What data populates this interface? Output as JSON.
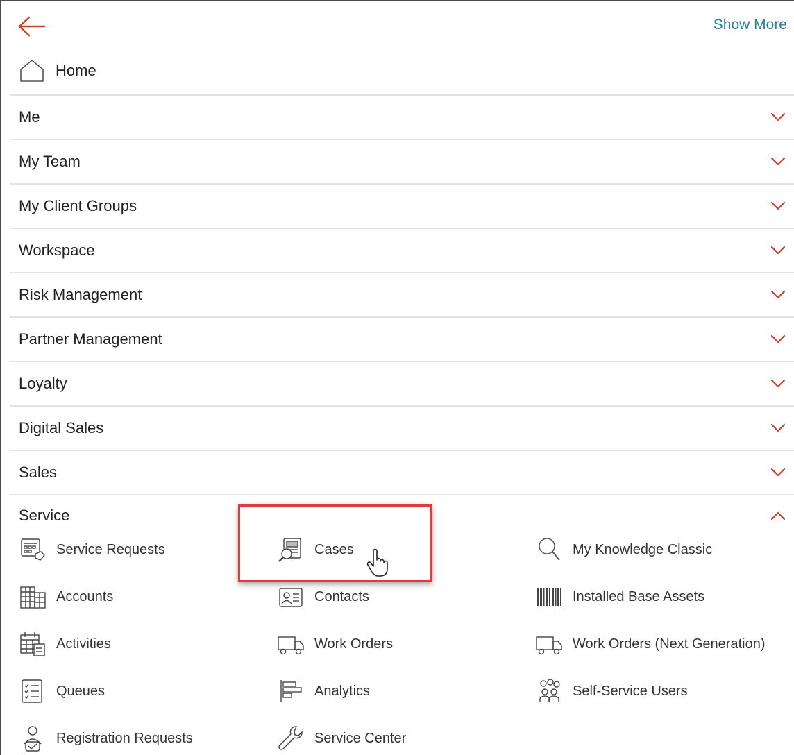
{
  "header": {
    "show_more_label": "Show More",
    "home_label": "Home",
    "colors": {
      "accent": "#c8412f",
      "link": "#2a7f96",
      "highlight": "#e03a3a"
    }
  },
  "nav": {
    "items": [
      {
        "label": "Me",
        "icon": "chevron-down-icon"
      },
      {
        "label": "My Team",
        "icon": "chevron-down-icon"
      },
      {
        "label": "My Client Groups",
        "icon": "chevron-down-icon"
      },
      {
        "label": "Workspace",
        "icon": "chevron-down-icon"
      },
      {
        "label": "Risk Management",
        "icon": "chevron-down-icon"
      },
      {
        "label": "Partner Management",
        "icon": "chevron-down-icon"
      },
      {
        "label": "Loyalty",
        "icon": "chevron-down-icon"
      },
      {
        "label": "Digital Sales",
        "icon": "chevron-down-icon"
      },
      {
        "label": "Sales",
        "icon": "chevron-down-icon"
      }
    ],
    "expanded": {
      "label": "Service",
      "icon": "chevron-up-icon"
    }
  },
  "service": {
    "tiles": [
      {
        "label": "Service Requests",
        "icon": "service-requests-icon"
      },
      {
        "label": "Cases",
        "icon": "cases-icon"
      },
      {
        "label": "My Knowledge Classic",
        "icon": "search-icon"
      },
      {
        "label": "Accounts",
        "icon": "buildings-icon"
      },
      {
        "label": "Contacts",
        "icon": "contact-card-icon"
      },
      {
        "label": "Installed Base Assets",
        "icon": "barcode-icon"
      },
      {
        "label": "Activities",
        "icon": "calendar-icon"
      },
      {
        "label": "Work Orders",
        "icon": "truck-icon"
      },
      {
        "label": "Work Orders (Next Generation)",
        "icon": "truck-icon"
      },
      {
        "label": "Queues",
        "icon": "checklist-icon"
      },
      {
        "label": "Analytics",
        "icon": "analytics-icon"
      },
      {
        "label": "Self-Service Users",
        "icon": "users-group-icon"
      },
      {
        "label": "Registration Requests",
        "icon": "user-check-icon"
      },
      {
        "label": "Service Center",
        "icon": "wrench-icon"
      }
    ]
  }
}
